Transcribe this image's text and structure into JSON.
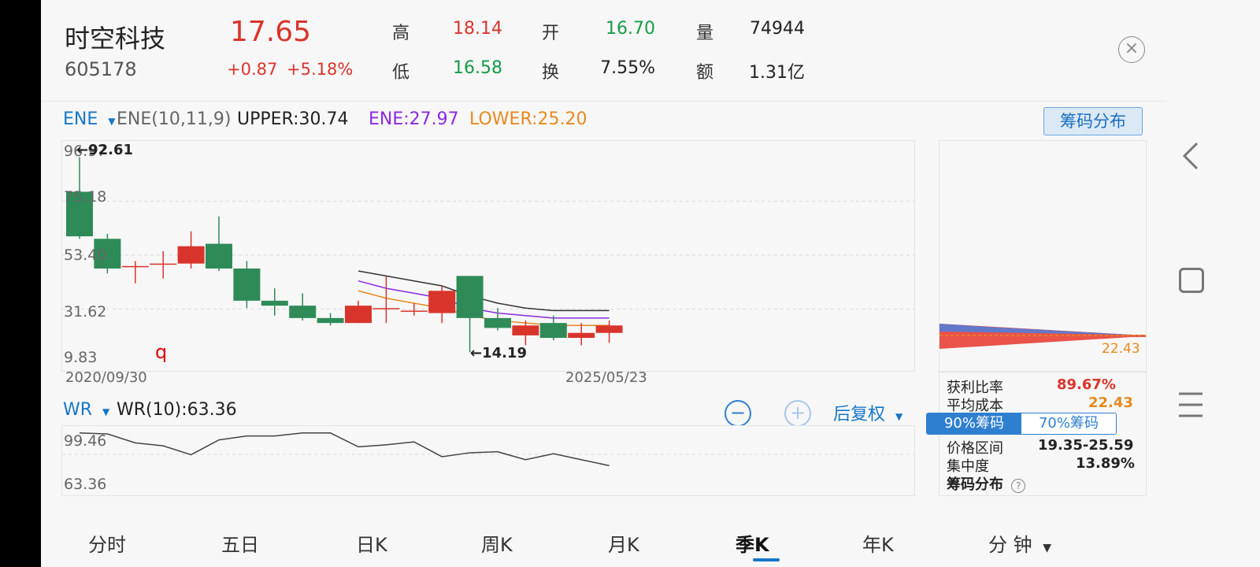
{
  "header": {
    "name": "时空科技",
    "code": "605178",
    "price": "17.65",
    "change": "+0.87",
    "change_pct": "+5.18%",
    "quotes": [
      {
        "label": "高",
        "value": "18.14",
        "color": "red"
      },
      {
        "label": "开",
        "value": "16.70",
        "color": "green"
      },
      {
        "label": "量",
        "value": "74944",
        "color": "dark"
      },
      {
        "label": "低",
        "value": "16.58",
        "color": "green"
      },
      {
        "label": "换",
        "value": "7.55%",
        "color": "dark"
      },
      {
        "label": "额",
        "value": "1.31亿",
        "color": "dark"
      }
    ]
  },
  "indicator": {
    "selector": "ENE",
    "params": "ENE(10,11,9)",
    "upper": "UPPER:30.74",
    "ene": "ENE:27.97",
    "lower": "LOWER:25.20",
    "chip_button": "筹码分布"
  },
  "kline": {
    "y_labels": [
      "96.97",
      "75.18",
      "53.40",
      "31.62",
      "9.83"
    ],
    "max_label": "92.61",
    "min_label": "14.19",
    "start_date": "2020/09/30",
    "end_date": "2025/05/23",
    "marker": "q"
  },
  "wr": {
    "selector": "WR",
    "value": "WR(10):63.36",
    "y_labels": [
      "99.46",
      "63.36"
    ],
    "adjust": "后复权"
  },
  "chips": {
    "avg_price_label": "22.43",
    "profit_ratio_label": "获利比率",
    "profit_ratio": "89.67%",
    "avg_cost_label": "平均成本",
    "avg_cost": "22.43",
    "tab_90": "90%筹码",
    "tab_70": "70%筹码",
    "range_label": "价格区间",
    "range": "19.35-25.59",
    "concentration_label": "集中度",
    "concentration": "13.89%",
    "footer": "筹码分布"
  },
  "tabs": [
    "分时",
    "五日",
    "日K",
    "周K",
    "月K",
    "季K",
    "年K",
    "分 钟"
  ],
  "active_tab": "季K",
  "colors": {
    "up": "#d9342b",
    "down": "#2e8b57",
    "accent": "#1677c8",
    "ene_upper": "#333333",
    "ene_mid": "#8a2be2",
    "ene_lower": "#e8891e"
  },
  "chart_data": {
    "type": "candlestick",
    "x_range": [
      "2020/09/30",
      "2025/05/23"
    ],
    "ylim": [
      9.83,
      96.97
    ],
    "candles": [
      {
        "o": 79,
        "c": 61,
        "h": 93,
        "l": 60
      },
      {
        "o": 60,
        "c": 48,
        "h": 62,
        "l": 46
      },
      {
        "o": 49,
        "c": 49,
        "h": 51,
        "l": 42
      },
      {
        "o": 50,
        "c": 50,
        "h": 55,
        "l": 44
      },
      {
        "o": 50,
        "c": 57,
        "h": 63,
        "l": 48
      },
      {
        "o": 58,
        "c": 48,
        "h": 69,
        "l": 47
      },
      {
        "o": 48,
        "c": 35,
        "h": 51,
        "l": 32
      },
      {
        "o": 35,
        "c": 33,
        "h": 40,
        "l": 29
      },
      {
        "o": 33,
        "c": 28,
        "h": 38,
        "l": 27
      },
      {
        "o": 28,
        "c": 26,
        "h": 30,
        "l": 25
      },
      {
        "o": 26,
        "c": 33,
        "h": 35,
        "l": 26
      },
      {
        "o": 32,
        "c": 32,
        "h": 45,
        "l": 26
      },
      {
        "o": 31,
        "c": 31,
        "h": 34,
        "l": 29
      },
      {
        "o": 30,
        "c": 39,
        "h": 41,
        "l": 26
      },
      {
        "o": 45,
        "c": 28,
        "h": 45,
        "l": 14.19
      },
      {
        "o": 28,
        "c": 24,
        "h": 32,
        "l": 23
      },
      {
        "o": 21,
        "c": 25,
        "h": 27,
        "l": 17
      },
      {
        "o": 26,
        "c": 20,
        "h": 29,
        "l": 19
      },
      {
        "o": 20,
        "c": 22,
        "h": 26,
        "l": 17
      },
      {
        "o": 22,
        "c": 25,
        "h": 27,
        "l": 18
      }
    ],
    "ene_upper": [
      null,
      null,
      null,
      null,
      null,
      null,
      null,
      null,
      null,
      null,
      47,
      45,
      43,
      41,
      37,
      34,
      32,
      31,
      31,
      31
    ],
    "ene_mid": [
      null,
      null,
      null,
      null,
      null,
      null,
      null,
      null,
      null,
      null,
      43,
      40,
      38,
      36,
      32,
      30,
      29,
      28,
      28,
      28
    ],
    "ene_lower": [
      null,
      null,
      null,
      null,
      null,
      null,
      null,
      null,
      null,
      null,
      39,
      36,
      34,
      32,
      29,
      27,
      26,
      25,
      25,
      25
    ],
    "wr": {
      "ylim": [
        40,
        110
      ],
      "values": [
        103,
        102,
        93,
        90,
        81,
        96,
        100,
        100,
        103,
        103,
        89,
        91,
        94,
        79,
        83,
        84,
        76,
        82,
        76,
        70
      ]
    }
  }
}
